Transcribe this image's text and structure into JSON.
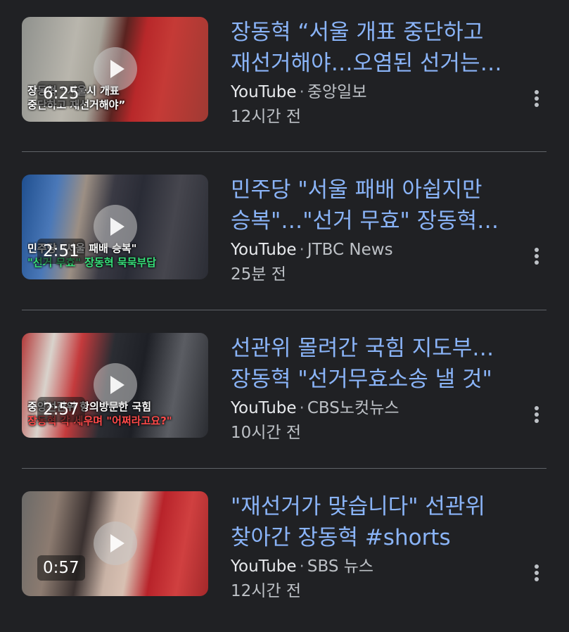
{
  "videos": [
    {
      "duration": "6:25",
      "title_line1": "장동혁 “서울 개표 중단하고",
      "title_line2": "재선거해야…오염된 선거는…",
      "source": "YouTube",
      "channel": "중앙일보",
      "time": "12시간 전",
      "thumb_caption1": "장동혁 “서울시 개표",
      "thumb_caption2": "중단하고 재선거해야”"
    },
    {
      "duration": "2:51",
      "title_line1": "민주당 \"서울 패배 아쉽지만",
      "title_line2": "승복\"…\"선거 무효\" 장동혁…",
      "source": "YouTube",
      "channel": "JTBC News",
      "time": "25분 전",
      "thumb_caption1": "민주당 \"서울 패배 승복\"",
      "thumb_caption2": "\"선거 무효\" 장동혁 묵묵부답"
    },
    {
      "duration": "2:57",
      "title_line1": "선관위 몰려간 국힘 지도부…",
      "title_line2": "장동혁 \"선거무효소송 낼 것\"",
      "source": "YouTube",
      "channel": "CBS노컷뉴스",
      "time": "10시간 전",
      "thumb_caption1": "중앙선관위 항의방문한 국힘",
      "thumb_caption2": "장동혁 각 세우며 \"어쩌라고요?\""
    },
    {
      "duration": "0:57",
      "title_line1": "\"재선거가 맞습니다\" 선관위",
      "title_line2": "찾아간 장동혁 #shorts",
      "source": "YouTube",
      "channel": "SBS 뉴스",
      "time": "12시간 전",
      "thumb_caption1": "",
      "thumb_caption2": ""
    }
  ],
  "separator": "·",
  "colors": {
    "background": "#202124",
    "title": "#8ab4f8",
    "meta": "#bdc1c6",
    "source": "#e8eaed",
    "divider": "#5f6368"
  },
  "icons": {
    "play": "play-icon",
    "more": "more-vert-icon"
  }
}
